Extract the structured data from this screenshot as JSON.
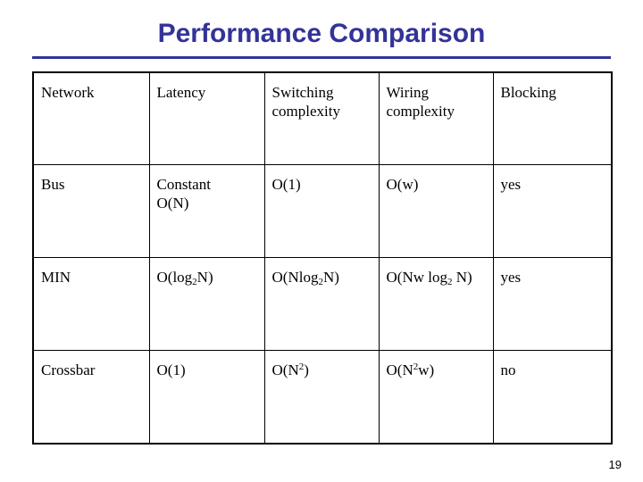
{
  "slide": {
    "title": "Performance Comparison",
    "title_color": "#333399",
    "rule_color": "#333399",
    "page_number": "19"
  },
  "table": {
    "headers": [
      "Network",
      "Latency",
      "Switching complexity",
      "Wiring complexity",
      "Blocking"
    ],
    "rows": [
      {
        "network": "Bus",
        "latency_line1": "Constant",
        "latency_line2": "O(N)",
        "switching_base": "O(1)",
        "switching_sub": "",
        "switching_sup": "",
        "switching_tail": "",
        "wiring_base": "O(w)",
        "wiring_sub": "",
        "wiring_sup": "",
        "wiring_tail": "",
        "blocking": "yes"
      },
      {
        "network": "MIN",
        "latency_base": "O(log",
        "latency_sub": "2",
        "latency_tail": "N)",
        "switching_base": "O(Nlog",
        "switching_sub": "2",
        "switching_sup": "",
        "switching_tail": "N)",
        "wiring_base": "O(Nw log",
        "wiring_sub": "2",
        "wiring_sup": "",
        "wiring_tail": " N)",
        "blocking": "yes"
      },
      {
        "network": "Crossbar",
        "latency_base": "O(1)",
        "latency_sub": "",
        "latency_tail": "",
        "switching_base": "O(N",
        "switching_sub": "",
        "switching_sup": "2",
        "switching_tail": ")",
        "wiring_base": "O(N",
        "wiring_sub": "",
        "wiring_sup": "2",
        "wiring_tail": "w)",
        "blocking": "no"
      }
    ]
  }
}
